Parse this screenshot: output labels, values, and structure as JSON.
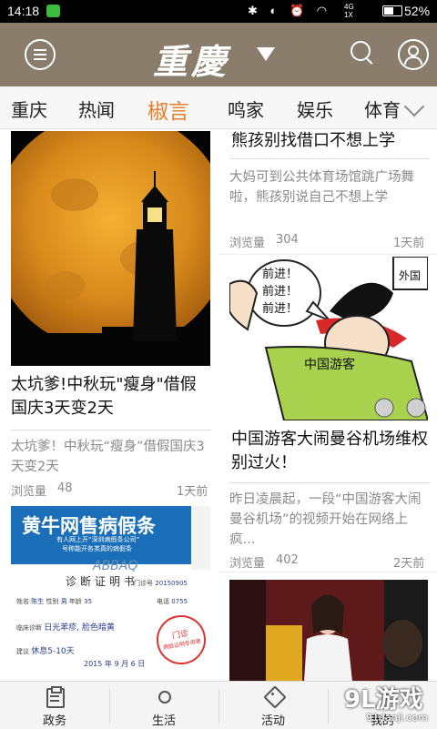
{
  "status": {
    "time": "14:18",
    "net": "4G",
    "net_sub": "1X",
    "battery": "52%"
  },
  "header": {
    "logo": "重慶"
  },
  "tabs": [
    "重庆",
    "热闻",
    "椒言",
    "鸣家",
    "娱乐",
    "体育"
  ],
  "active_tab": "椒言",
  "left_col": [
    {
      "title": "太坑爹!中秋玩\"瘦身\"借假国庆3天变2天",
      "summary": "太坑爹！中秋玩“瘦身”借假国庆3天变2天",
      "views_label": "浏览量",
      "views": "48",
      "time": "1天前"
    },
    {
      "ad_title": "黄牛网售病假条",
      "ad_sub1": "有人网上开“深圳病假条公司”",
      "ad_sub2": "号称能开各类真的病假条",
      "doc_title": "诊断证明书",
      "abbaq": "ABBAQ",
      "stamp_line1": "门诊",
      "stamp_line2": "病假证明专用章",
      "form_name_label": "姓名",
      "form_name": "陈生",
      "form_sex_label": "性别",
      "form_sex": "男",
      "form_age_label": "年龄",
      "form_age": "35",
      "form_num_label": "门诊号",
      "form_num": "20150905",
      "form_phone_label": "电话",
      "form_phone": "0755",
      "diag_label": "临床诊断",
      "diag": "日光苯疹, 脸色暗黄",
      "advice_label": "建议",
      "advice": "休息5-10天",
      "date": "2015 年 9 月 6 日"
    }
  ],
  "right_col": [
    {
      "title": "熊孩别找借口不想上学",
      "summary": "大妈可到公共体育场馆跳广场舞啦，熊孩别说自己不想上学",
      "views_label": "浏览量",
      "views": "304",
      "time": "1天前"
    },
    {
      "title": "中国游客大闹曼谷机场维权别过火！",
      "cartoon_speech": [
        "前进！",
        "前进！",
        "前进！"
      ],
      "cartoon_shirt": "中国游客",
      "cartoon_sign": "外国",
      "summary": "昨日凌晨起，一段“中国游客大闹曼谷机场”的视频开始在网络上疯...",
      "views_label": "浏览量",
      "views": "402",
      "time": "2天前"
    }
  ],
  "bottom_nav": [
    "政务",
    "生活",
    "活动",
    "我的"
  ],
  "watermark": {
    "brand": "9L游戏",
    "url": "91danji.com"
  }
}
